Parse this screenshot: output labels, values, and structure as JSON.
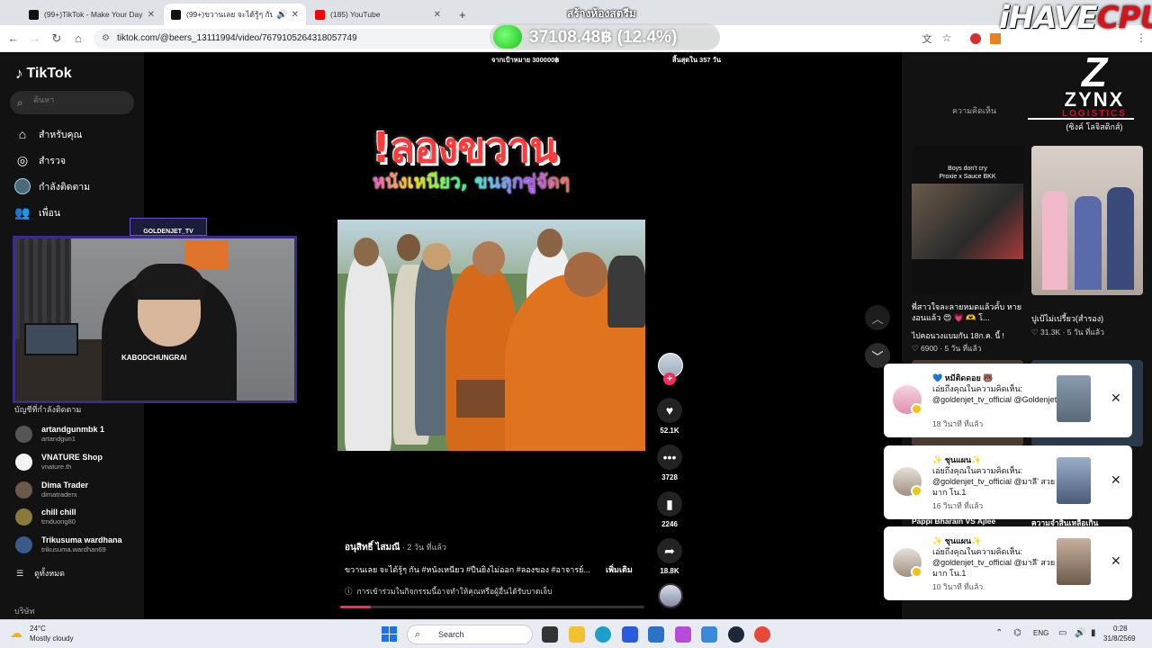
{
  "browser": {
    "tabs": [
      {
        "title": "(99+)TikTok - Make Your Day",
        "color": "#111"
      },
      {
        "title": "(99+)ขวานเลย จะได้รู้ๆ กัน #หนั",
        "color": "#111"
      },
      {
        "title": "(185) YouTube",
        "color": "#ff0000"
      }
    ],
    "new_tab": "+",
    "url": "tiktok.com/@beers_13111994/video/7679105264318057749"
  },
  "overlay": {
    "donation_label": "สร้างห้องสตรีม",
    "donation_amount": "37108.48฿ (12.4%)",
    "goal_text": "จากเป้าหมาย 300000฿",
    "remaining_text": "สิ้นสุดใน 357 วัน",
    "brand_a": "iHAVE",
    "brand_b": "CPU"
  },
  "sidebar": {
    "logo": "TikTok",
    "search_placeholder": "ค้นหา",
    "nav": [
      {
        "label": "สำหรับคุณ",
        "icon": "home-icon"
      },
      {
        "label": "สำรวจ",
        "icon": "compass-icon"
      },
      {
        "label": "กำลังติดตาม",
        "icon": "following-icon"
      },
      {
        "label": "เพื่อน",
        "icon": "friends-icon"
      }
    ],
    "following_title": "บัญชีที่กำลังติดตาม",
    "following": [
      {
        "name": "artandgunmbk 1",
        "user": "artandgun1",
        "color": "#555"
      },
      {
        "name": "VNATURE Shop",
        "user": "vnature.th",
        "color": "#f4f4f4"
      },
      {
        "name": "Dima Trader",
        "user": "dimatraderx",
        "color": "#6b5a4a"
      },
      {
        "name": "chill chill",
        "user": "trnduong80",
        "color": "#8a7a3a"
      },
      {
        "name": "Trikusuma wardhana",
        "user": "trikusuma.wardhan69",
        "color": "#3a5a8a"
      }
    ],
    "see_all": "ดูทั้งหมด",
    "company": "บริษัท"
  },
  "webcam": {
    "label": "GOLDENJET_TV",
    "shirt_text": "KABODCHUNGRAI"
  },
  "video": {
    "headline": "!ลองขวาน",
    "subhead": "หนังเหนียว, ขนลุกซู่จัดๆ",
    "author": "อนุสิทธิ์ ไสมณี",
    "time_ago": " · 2 วัน ที่แล้ว",
    "caption": "ขวานเลย จะได้รู้ๆ กัน #หนังเหนียว #ปืนยิงไม่ออก #ลองของ #อาจารย์...",
    "more": "เพิ่มเติม",
    "disclaimer": "การเข้าร่วมในกิจกรรมนี้อาจทำให้คุณหรือผู้อื่นได้รับบาดเจ็บ",
    "progress": 0.1
  },
  "actions": {
    "likes": "52.1K",
    "comments": "3728",
    "saves": "2246",
    "shares": "18.8K"
  },
  "right_panel": {
    "comments_tab": "ความคิดเห็น",
    "zynx": {
      "mark": "Z",
      "name": "ZYNX",
      "sub": "LOGISTICS",
      "thai": "(ซิงค์ โลจิสติกส์)"
    },
    "related": [
      {
        "title": "พี่สาวใจละลายหมดแล้วคั้บ หายงอนแล้ว 😍 💗 🫶 โ...",
        "sub": "ไปคอนวงแบมกัน 18ก.ค. นี้ !",
        "likes": "6900",
        "age": "5 วัน ที่แล้ว",
        "thumb_text_a": "Boys don't cry",
        "thumb_text_b": "Proxie x Sauce BKK"
      },
      {
        "title": "ปูเป้ไม่เปรี้ยว(สำรอง)",
        "sub": "",
        "likes": "31.3K",
        "age": "5 วัน ที่แล้ว"
      }
    ],
    "bottom_a": "Pappi Bharain VS Ajlee",
    "bottom_b": "ความจำสิ้นเหลือเกิน"
  },
  "notifications": [
    {
      "line1": "💙 หมีติดดอย 🐻",
      "line2": "เอ่ยถึงคุณในความคิดเห็น: @goldenjet_tv_official @Goldenjet",
      "time": "18 วินาที ที่แล้ว"
    },
    {
      "line1": "✨ ชุนแผน✨",
      "line2": "เอ่ยถึงคุณในความคิดเห็น: @goldenjet_tv_official @มาลี' สวยมาก โน.1",
      "time": "16 วินาที ที่แล้ว"
    },
    {
      "line1": "✨ ชุนแผน✨",
      "line2": "เอ่ยถึงคุณในความคิดเห็น: @goldenjet_tv_official @มาลี' สวยมาก โน.1",
      "time": "10 วินาที ที่แล้ว"
    }
  ],
  "taskbar": {
    "temp": "24°C",
    "weather": "Mostly cloudy",
    "search": "Search",
    "lang": "ENG",
    "time": "0:28",
    "date": "31/8/2569"
  }
}
